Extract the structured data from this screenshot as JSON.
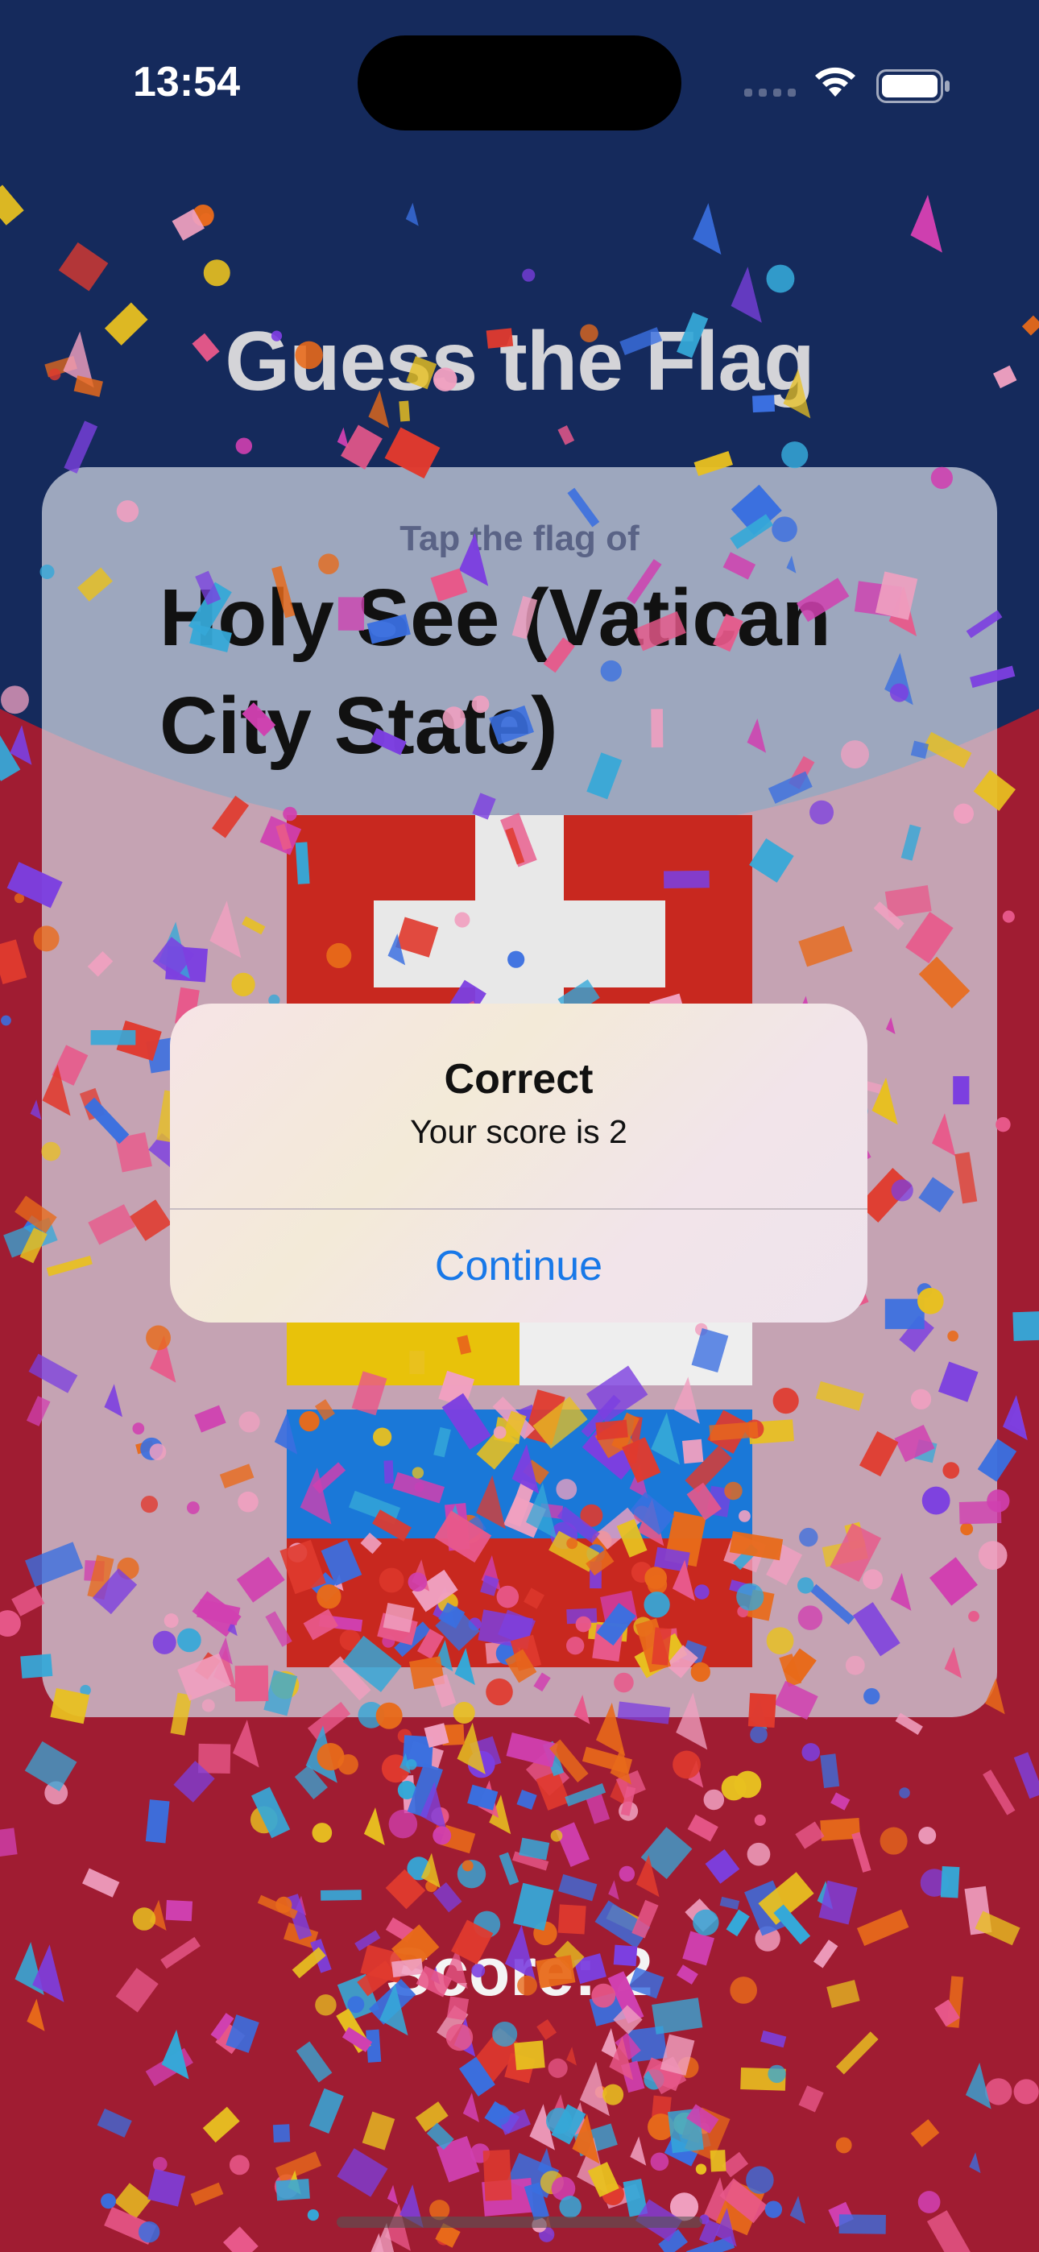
{
  "status_bar": {
    "time": "13:54"
  },
  "app": {
    "title": "Guess the Flag"
  },
  "question": {
    "prompt": "Tap the flag of",
    "country": "Holy See (Vatican City State)"
  },
  "flags": [
    {
      "name": "switzerland-flag"
    },
    {
      "name": "vatican-flag"
    },
    {
      "name": "flag-blue-red"
    }
  ],
  "score_label": "Score: 2",
  "alert": {
    "title": "Correct",
    "message": "Your score is 2",
    "button_label": "Continue"
  },
  "colors": {
    "background_top": "#152a5c",
    "background_bottom": "#a01c32",
    "accent_blue": "#1878e8"
  }
}
